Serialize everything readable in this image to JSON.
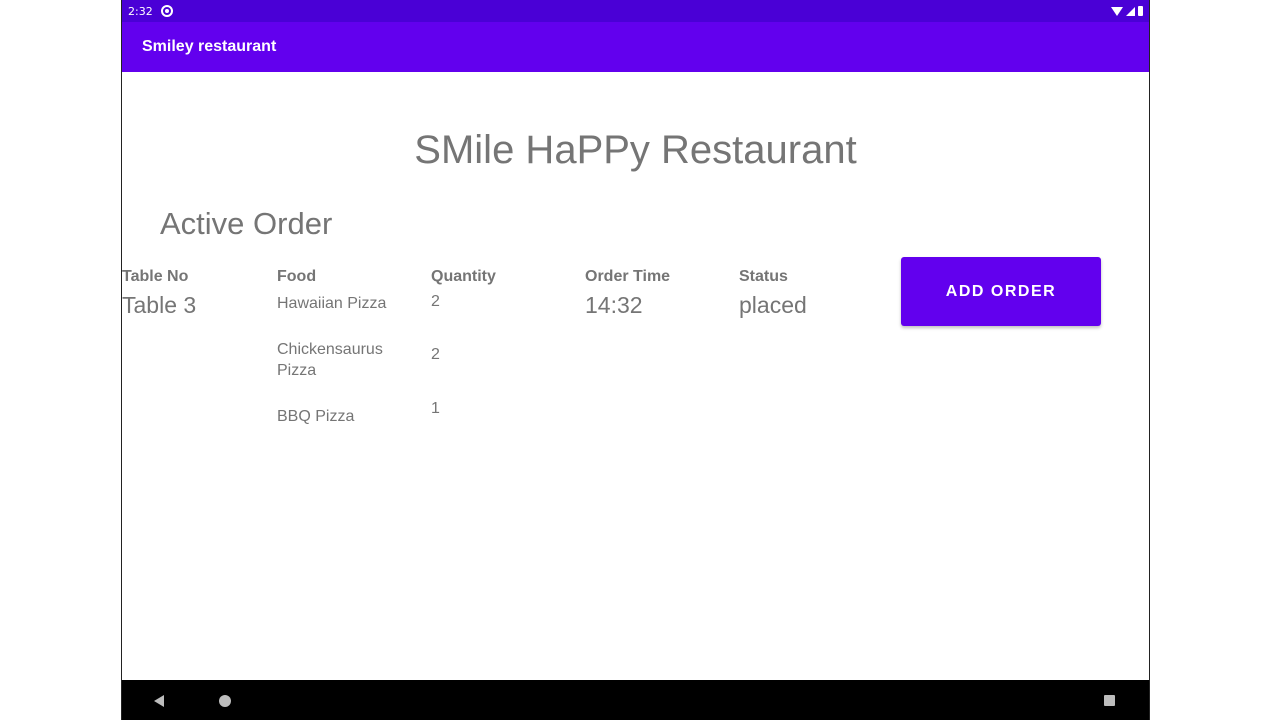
{
  "status_bar": {
    "time": "2:32"
  },
  "app_bar": {
    "title": "Smiley restaurant"
  },
  "main": {
    "restaurant_title": "SMile HaPPy Restaurant",
    "section_title": "Active Order",
    "columns": {
      "table_no": "Table No",
      "food": "Food",
      "quantity": "Quantity",
      "order_time": "Order Time",
      "status": "Status"
    },
    "order": {
      "table": "Table 3",
      "items": [
        {
          "food": "Hawaiian Pizza",
          "quantity": "2"
        },
        {
          "food": "Chickensaurus Pizza",
          "quantity": "2"
        },
        {
          "food": "BBQ Pizza",
          "quantity": "1"
        }
      ],
      "order_time": "14:32",
      "status": "placed"
    },
    "add_order_label": "ADD ORDER"
  },
  "colors": {
    "app_bar": "#6200ee",
    "status_bar": "#4a00d6",
    "text": "#757575"
  },
  "icons": {
    "status": [
      "sync-icon",
      "wifi-icon",
      "signal-icon",
      "battery-icon"
    ],
    "nav": [
      "back-icon",
      "home-icon",
      "recents-icon"
    ]
  }
}
